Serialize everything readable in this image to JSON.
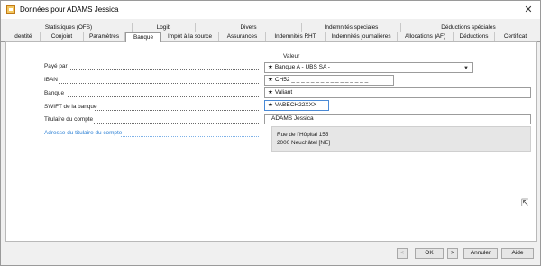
{
  "window": {
    "title": "Données pour ADAMS Jessica",
    "close_glyph": "✕"
  },
  "tabs_row1": [
    {
      "label": "Statistiques (OFS)"
    },
    {
      "label": "Logib"
    },
    {
      "label": "Divers"
    },
    {
      "label": "Indemnités spéciales"
    },
    {
      "label": "Déductions spéciales"
    }
  ],
  "tabs_row2": [
    {
      "label": "Identité"
    },
    {
      "label": "Conjoint"
    },
    {
      "label": "Paramètres"
    },
    {
      "label": "Banque",
      "active": true
    },
    {
      "label": "Impôt à la source"
    },
    {
      "label": "Assurances"
    },
    {
      "label": "Indemnités RHT"
    },
    {
      "label": "Indemnités journalières"
    },
    {
      "label": "Allocations (AF)"
    },
    {
      "label": "Déductions"
    },
    {
      "label": "Certificat"
    }
  ],
  "form": {
    "value_header": "Valeur",
    "fields": {
      "paye_par": {
        "label": "Payé par",
        "value": "Banque A - UBS SA -",
        "starred": true
      },
      "iban": {
        "label": "IBAN",
        "value": "CH52 _ _ _ _ _ _ _ _ _ _ _ _ _ _ _ _",
        "starred": true
      },
      "banque": {
        "label": "Banque",
        "value": "Valiant",
        "starred": true
      },
      "swift": {
        "label": "SWIFT de la banque",
        "value": "VABECH22XXX",
        "starred": true
      },
      "titulaire": {
        "label": "Titulaire du compte",
        "value": "ADAMS Jessica"
      },
      "adresse": {
        "label": "Adresse du titulaire du compte",
        "line1": "Rue de l'Hôpital 155",
        "line2": "2000 Neuchâtel [NE]"
      }
    },
    "star_glyph": "★"
  },
  "buttons": {
    "prev": "<",
    "ok": "OK",
    "next": ">",
    "cancel": "Annuler",
    "help": "Aide"
  },
  "colors": {
    "link": "#2a7fd4",
    "focus": "#4a8ad6",
    "panel": "#ffffff",
    "window_bg": "#f0f0f0"
  }
}
